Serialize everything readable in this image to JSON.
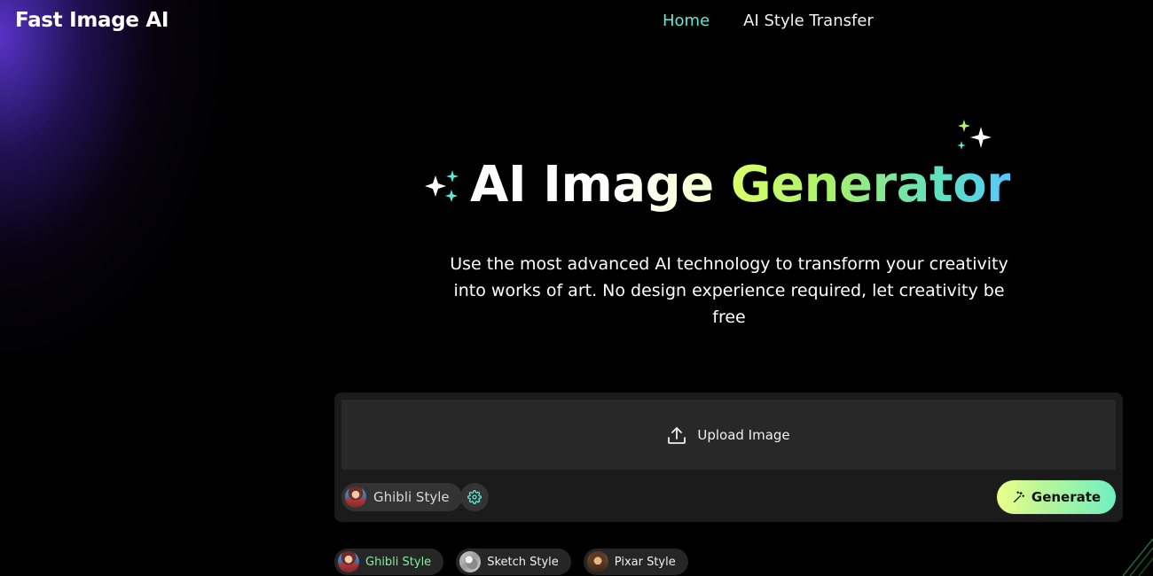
{
  "header": {
    "brand": "Fast Image AI",
    "nav": [
      {
        "label": "Home",
        "active": true
      },
      {
        "label": "AI Style Transfer",
        "active": false
      }
    ]
  },
  "hero": {
    "title_part1": "AI Image ",
    "title_part2": "Generator",
    "subtitle": "Use the most advanced AI technology to transform your creativity into works of art. No design experience required, let creativity be free"
  },
  "panel": {
    "upload_label": "Upload Image",
    "upload_icon": "upload-icon",
    "selected_style": "Ghibli Style",
    "settings_icon": "gear-icon",
    "generate_label": "Generate",
    "generate_icon": "magic-wand-icon"
  },
  "presets": [
    {
      "label": "Ghibli Style",
      "active": true
    },
    {
      "label": "Sketch Style",
      "active": false
    },
    {
      "label": "Pixar Style",
      "active": false
    }
  ],
  "colors": {
    "accent": "#5eead4",
    "generate_gradient": [
      "#e9ff8a",
      "#6ff0c2"
    ],
    "title_gradient": [
      "#dcff6a",
      "#56c8ff"
    ]
  }
}
